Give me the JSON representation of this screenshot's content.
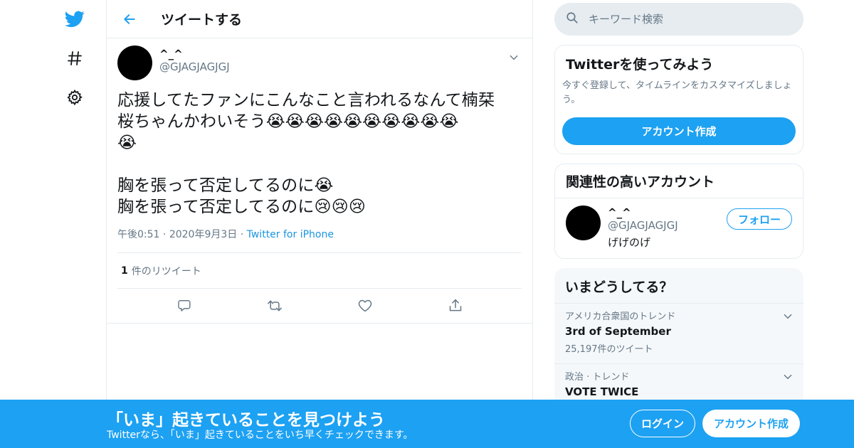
{
  "colors": {
    "accent": "#1da1f2",
    "text": "#14171a",
    "muted": "#657786",
    "border": "#e6ecf0"
  },
  "nav": {
    "items": [
      {
        "icon": "twitter-bird-icon"
      },
      {
        "icon": "hashtag-icon"
      },
      {
        "icon": "gear-icon"
      }
    ]
  },
  "header": {
    "title": "ツイートする",
    "back_icon": "back-arrow-icon"
  },
  "tweet": {
    "author_name": "^_^",
    "author_handle": "@GJAGJAGJGJ",
    "text": "応援してたファンにこんなこと言われるなんて楠栞\n桜ちゃんかわいそう😭😭😭😭😭😭😭😭😭😭\n😭\n\n胸を張って否定してるのに😭\n胸を張って否定してるのに😢😢😢",
    "time": "午後0:51",
    "date": "2020年9月3日",
    "source": "Twitter for iPhone",
    "retweet_count": "1",
    "retweet_label": "件のリツイート",
    "actions": [
      "reply-icon",
      "retweet-icon",
      "like-icon",
      "share-icon"
    ]
  },
  "search": {
    "placeholder": "キーワード検索"
  },
  "signup_card": {
    "title": "Twitterを使ってみよう",
    "desc": "今すぐ登録して、タイムラインをカスタマイズしましょう。",
    "button": "アカウント作成"
  },
  "related": {
    "title": "関連性の高いアカウント",
    "name": "^_^",
    "handle": "@GJAGJAGJGJ",
    "bio": "げげのげ",
    "follow": "フォロー"
  },
  "trends": {
    "title": "いまどうしてる？",
    "items": [
      {
        "category": "アメリカ合衆国のトレンド",
        "name": "3rd of September",
        "count": "25,197件のツイート"
      },
      {
        "category": "政治 · トレンド",
        "name": "VOTE TWICE",
        "count": ""
      }
    ]
  },
  "bottom_bar": {
    "title": "「いま」起きていることを見つけよう",
    "subtitle": "Twitterなら、「いま」起きていることをいち早くチェックできます。",
    "login": "ログイン",
    "signup": "アカウント作成"
  }
}
